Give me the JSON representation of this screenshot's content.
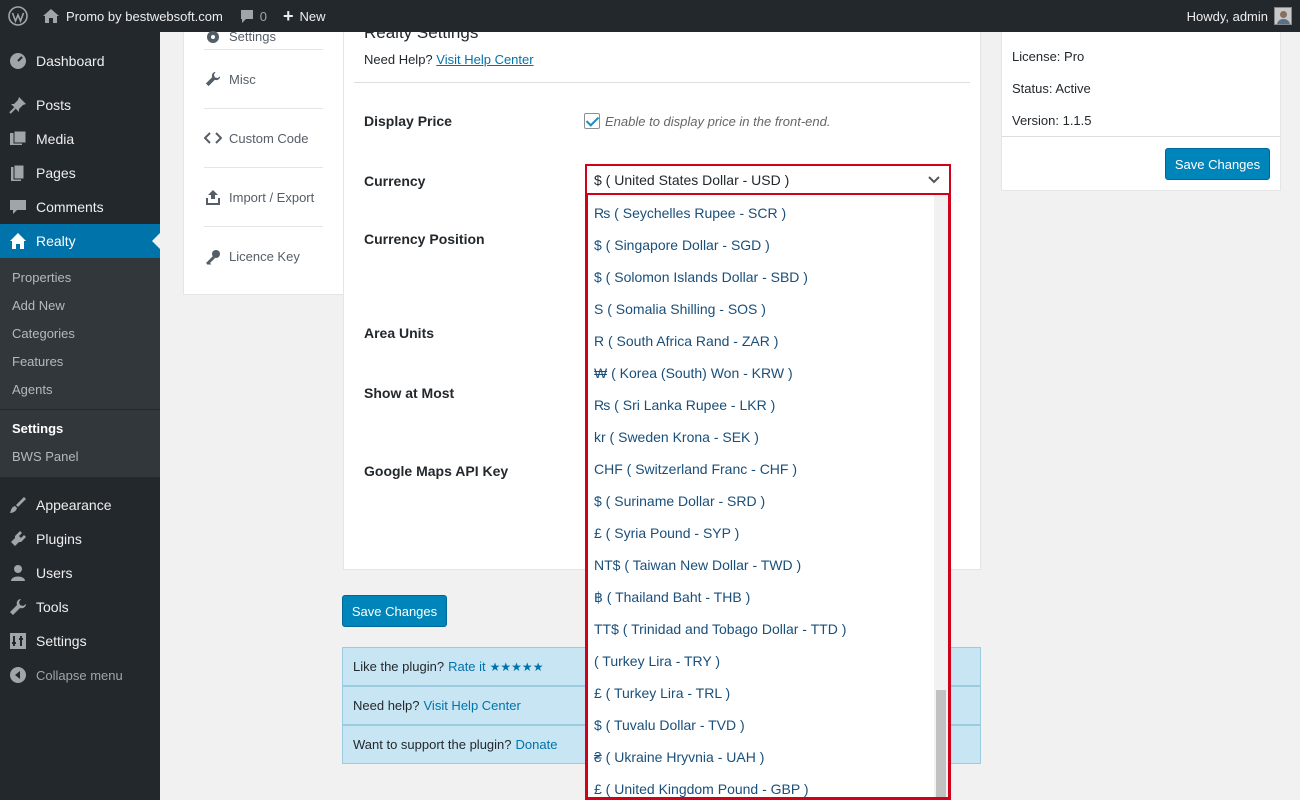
{
  "adminbar": {
    "site_name": "Promo by bestwebsoft.com",
    "comments_count": "0",
    "new_label": "New",
    "howdy": "Howdy, admin"
  },
  "sidebar": {
    "items": [
      {
        "label": "Dashboard",
        "icon": "dashboard-icon"
      },
      {
        "label": "Posts",
        "icon": "pin-icon"
      },
      {
        "label": "Media",
        "icon": "media-icon"
      },
      {
        "label": "Pages",
        "icon": "pages-icon"
      },
      {
        "label": "Comments",
        "icon": "comments-icon"
      },
      {
        "label": "Realty",
        "icon": "home-icon"
      }
    ],
    "submenu": [
      "Properties",
      "Add New",
      "Categories",
      "Features",
      "Agents",
      "Settings",
      "BWS Panel"
    ],
    "lower_items": [
      {
        "label": "Appearance",
        "icon": "brush-icon"
      },
      {
        "label": "Plugins",
        "icon": "plug-icon"
      },
      {
        "label": "Users",
        "icon": "user-icon"
      },
      {
        "label": "Tools",
        "icon": "wrench-icon"
      },
      {
        "label": "Settings",
        "icon": "settings-icon"
      }
    ],
    "collapse_label": "Collapse menu"
  },
  "tabs": {
    "items": [
      "Settings",
      "Misc",
      "Custom Code",
      "Import / Export",
      "Licence Key"
    ]
  },
  "main": {
    "title": "Realty Settings",
    "help_prefix": "Need Help?",
    "help_link": "Visit Help Center",
    "display_price_label": "Display Price",
    "display_price_desc": "Enable to display price in the front-end.",
    "currency_label": "Currency",
    "currency_position_label": "Currency Position",
    "area_units_label": "Area Units",
    "show_at_most_label": "Show at Most",
    "gmaps_label": "Google Maps API Key",
    "save_label": "Save Changes"
  },
  "license_box": {
    "license": "License: Pro",
    "status": "Status: Active",
    "version": "Version: 1.1.5",
    "save_label": "Save Changes"
  },
  "info": {
    "like_text": "Like the plugin?",
    "rate_link": "Rate it",
    "stars": "★★★★★",
    "help_text": "Need help?",
    "help_link": "Visit Help Center",
    "support_text": "Want to support the plugin?",
    "donate_link": "Donate"
  },
  "currency_dropdown": {
    "selected": "$ ( United States Dollar - USD )",
    "options": [
      "₨ ( Seychelles Rupee - SCR )",
      "$ ( Singapore Dollar - SGD )",
      "$ ( Solomon Islands Dollar - SBD )",
      "S ( Somalia Shilling - SOS )",
      "R ( South Africa Rand - ZAR )",
      "₩ ( Korea (South) Won - KRW )",
      "₨ ( Sri Lanka Rupee - LKR )",
      "kr ( Sweden Krona - SEK )",
      "CHF ( Switzerland Franc - CHF )",
      "$ ( Suriname Dollar - SRD )",
      "£ ( Syria Pound - SYP )",
      "NT$ ( Taiwan New Dollar - TWD )",
      "฿ ( Thailand Baht - THB )",
      "TT$ ( Trinidad and Tobago Dollar - TTD )",
      "( Turkey Lira - TRY )",
      "£ ( Turkey Lira - TRL )",
      "$ ( Tuvalu Dollar - TVD )",
      "₴ ( Ukraine Hryvnia - UAH )",
      "£ ( United Kingdom Pound - GBP )"
    ]
  }
}
